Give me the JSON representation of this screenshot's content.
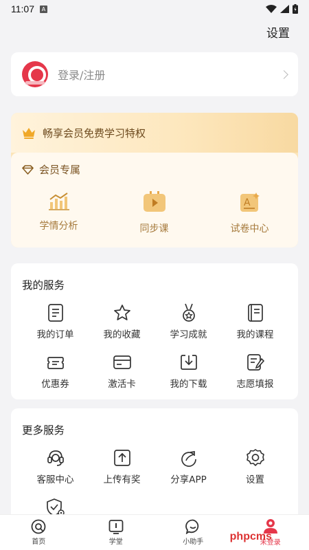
{
  "status_bar": {
    "time": "11:07"
  },
  "header": {
    "settings_label": "设置"
  },
  "login": {
    "label": "登录/注册"
  },
  "vip": {
    "banner_text": "畅享会员免费学习特权",
    "section_title": "会员专属",
    "features": [
      {
        "label": "学情分析",
        "icon": "analysis-chart-icon"
      },
      {
        "label": "同步课",
        "icon": "video-play-icon"
      },
      {
        "label": "试卷中心",
        "icon": "exam-paper-icon"
      }
    ],
    "accent_color": "#a67a3c"
  },
  "my_services": {
    "title": "我的服务",
    "items": [
      {
        "label": "我的订单",
        "icon": "order-document-icon"
      },
      {
        "label": "我的收藏",
        "icon": "star-icon"
      },
      {
        "label": "学习成就",
        "icon": "medal-icon"
      },
      {
        "label": "我的课程",
        "icon": "course-book-icon"
      },
      {
        "label": "优惠券",
        "icon": "coupon-icon"
      },
      {
        "label": "激活卡",
        "icon": "card-icon"
      },
      {
        "label": "我的下载",
        "icon": "download-icon"
      },
      {
        "label": "志愿填报",
        "icon": "form-edit-icon"
      }
    ]
  },
  "more_services": {
    "title": "更多服务",
    "items": [
      {
        "label": "客服中心",
        "icon": "headset-icon"
      },
      {
        "label": "上传有奖",
        "icon": "upload-icon"
      },
      {
        "label": "分享APP",
        "icon": "share-icon"
      },
      {
        "label": "设置",
        "icon": "gear-icon"
      },
      {
        "label": "",
        "icon": "shield-settings-icon"
      }
    ]
  },
  "bottom_nav": [
    {
      "label": "首页",
      "icon": "home-icon"
    },
    {
      "label": "学堂",
      "icon": "classroom-icon"
    },
    {
      "label": "小助手",
      "icon": "assistant-chat-icon"
    },
    {
      "label": "未登录",
      "icon": "profile-icon",
      "active": true
    }
  ],
  "watermark": "phpcms",
  "colors": {
    "brand_red": "#e5374a",
    "vip_gold": "#f4b942"
  }
}
